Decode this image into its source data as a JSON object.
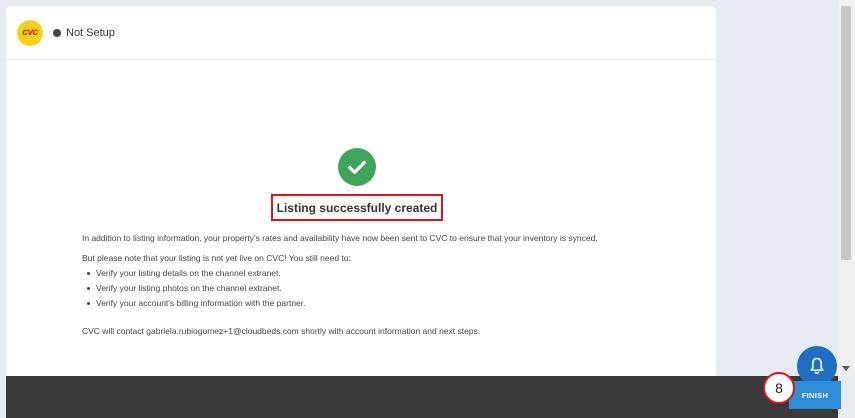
{
  "header": {
    "logo_text": "cvc",
    "status": "Not Setup"
  },
  "main": {
    "title": "Listing successfully created",
    "intro": "In addition to listing information, your property's rates and availability have now been sent to CVC to ensure that your inventory is synced.",
    "note": "But please note that your listing is not yet live on CVC! You still need to:",
    "steps": [
      "Verify your listing details on the channel extranet.",
      "Verify your listing photos on the channel extranet.",
      "Verify your account's billing information with the partner."
    ],
    "contact": "CVC will contact gabriela.rubiogomez+1@cloudbeds.com shortly with account information and next steps."
  },
  "footer": {
    "finish_label": "FINISH"
  },
  "annotation": {
    "step_number": "8"
  },
  "colors": {
    "success": "#3fa55c",
    "highlight": "#d8161d",
    "primary": "#2f8cd8",
    "bell": "#1e6ec4"
  },
  "icons": {
    "check": "check-circle-icon",
    "bell": "bell-icon"
  }
}
